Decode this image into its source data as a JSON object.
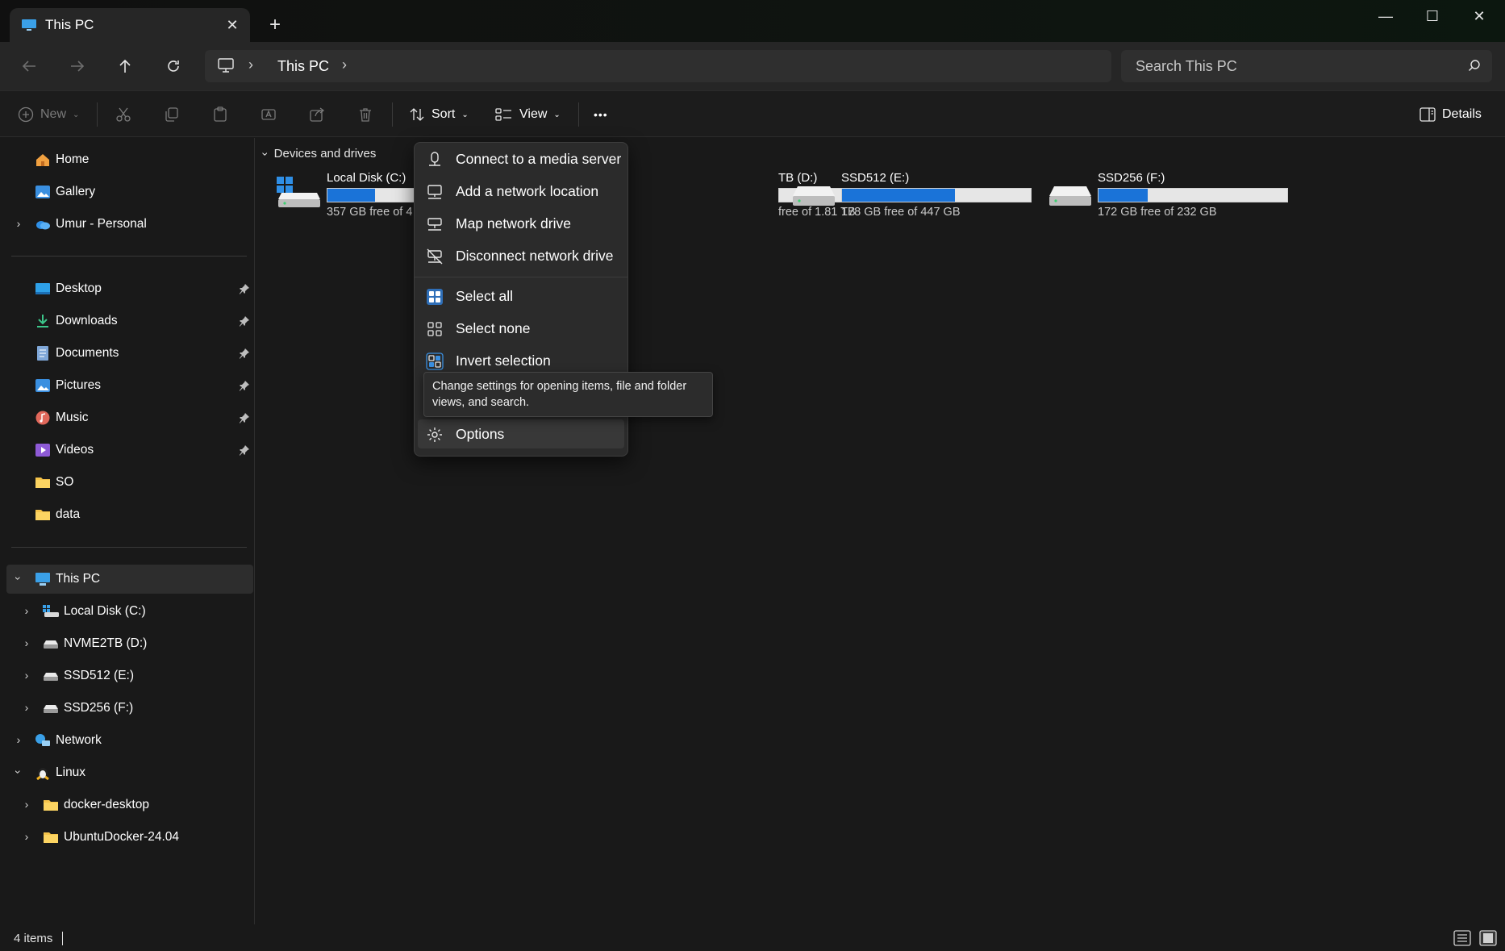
{
  "window": {
    "tab_title": "This PC",
    "tab_close": "✕",
    "new_tab": "+",
    "minimize": "—",
    "maximize": "☐",
    "close": "✕"
  },
  "address": {
    "crumb": "This PC",
    "search_placeholder": "Search This PC"
  },
  "commandbar": {
    "new_label": "New",
    "sort_label": "Sort",
    "view_label": "View",
    "more_label": "•••",
    "details_label": "Details"
  },
  "sidebar": {
    "quick": [
      {
        "label": "Home",
        "icon": "home-icon"
      },
      {
        "label": "Gallery",
        "icon": "gallery-icon"
      },
      {
        "label": "Umur - Personal",
        "icon": "onedrive-icon"
      }
    ],
    "pinned": [
      {
        "label": "Desktop",
        "icon": "desktop-folder-icon"
      },
      {
        "label": "Downloads",
        "icon": "downloads-icon"
      },
      {
        "label": "Documents",
        "icon": "documents-icon"
      },
      {
        "label": "Pictures",
        "icon": "pictures-icon"
      },
      {
        "label": "Music",
        "icon": "music-icon"
      },
      {
        "label": "Videos",
        "icon": "videos-icon"
      },
      {
        "label": "SO",
        "icon": "folder-icon"
      },
      {
        "label": "data",
        "icon": "folder-icon"
      }
    ],
    "tree": [
      {
        "label": "This PC",
        "icon": "pc-icon"
      },
      {
        "label": "Local Disk (C:)",
        "icon": "windows-drive-icon"
      },
      {
        "label": "NVME2TB (D:)",
        "icon": "drive-icon"
      },
      {
        "label": "SSD512 (E:)",
        "icon": "drive-icon"
      },
      {
        "label": "SSD256 (F:)",
        "icon": "drive-icon"
      },
      {
        "label": "Network",
        "icon": "network-icon"
      },
      {
        "label": "Linux",
        "icon": "linux-icon"
      },
      {
        "label": "docker-desktop",
        "icon": "folder-icon"
      },
      {
        "label": "UbuntuDocker-24.04",
        "icon": "folder-icon"
      }
    ]
  },
  "content": {
    "group_header": "Devices and drives",
    "drives": [
      {
        "name": "Local Disk (C:)",
        "free": "357 GB free of 4",
        "used_fraction": 0.25
      },
      {
        "name": "TB (D:)",
        "free": "free of 1.81 TB",
        "used_fraction": 0.0
      },
      {
        "name": "SSD512 (E:)",
        "free": "178 GB free of 447 GB",
        "used_fraction": 0.6
      },
      {
        "name": "SSD256 (F:)",
        "free": "172 GB free of 232 GB",
        "used_fraction": 0.26
      }
    ]
  },
  "menu": {
    "items": [
      {
        "label": "Connect to a media server",
        "icon": "media-server-icon"
      },
      {
        "label": "Add a network location",
        "icon": "network-location-icon"
      },
      {
        "label": "Map network drive",
        "icon": "map-drive-icon"
      },
      {
        "label": "Disconnect network drive",
        "icon": "disconnect-drive-icon"
      },
      {
        "label": "Select all",
        "icon": "select-all-icon"
      },
      {
        "label": "Select none",
        "icon": "select-none-icon"
      },
      {
        "label": "Invert selection",
        "icon": "invert-selection-icon"
      },
      {
        "label": "Options",
        "icon": "gear-icon"
      }
    ],
    "tooltip": "Change settings for opening items, file and folder views, and search."
  },
  "status": {
    "count": "4 items"
  },
  "colors": {
    "accent": "#1a73d8",
    "background": "#191919",
    "menu": "#2b2b2b"
  }
}
